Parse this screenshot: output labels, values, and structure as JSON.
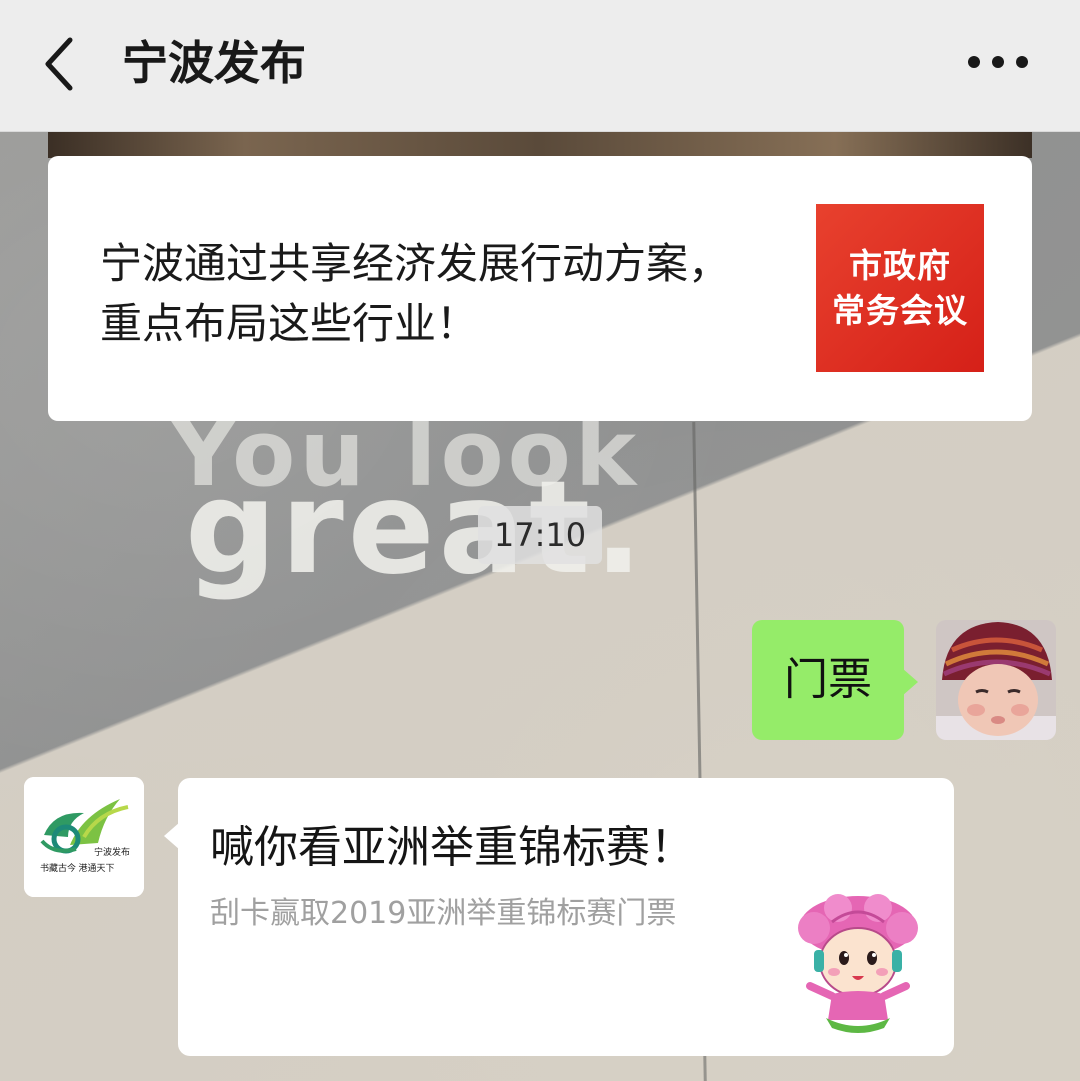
{
  "header": {
    "title": "宁波发布",
    "back_icon": "chevron-left-icon",
    "more_icon": "ellipsis-icon"
  },
  "wallpaper": {
    "ground_text_top": "You look",
    "ground_text_main": "great."
  },
  "messages": {
    "article": {
      "title": "宁波通过共享经济发展行动方案，重点布局这些行业！",
      "thumbnail_line1": "市政府",
      "thumbnail_line2": "常务会议",
      "thumbnail_color": "#e0321f"
    },
    "timestamp": "17:10",
    "outgoing": {
      "text": "门票",
      "bubble_color": "#95ec69"
    },
    "incoming_card": {
      "title": "喊你看亚洲举重锦标赛！",
      "description": "刮卡赢取2019亚洲举重锦标赛门票",
      "logo_name": "宁波发布",
      "logo_slogan": "书藏古今 港通天下"
    }
  }
}
